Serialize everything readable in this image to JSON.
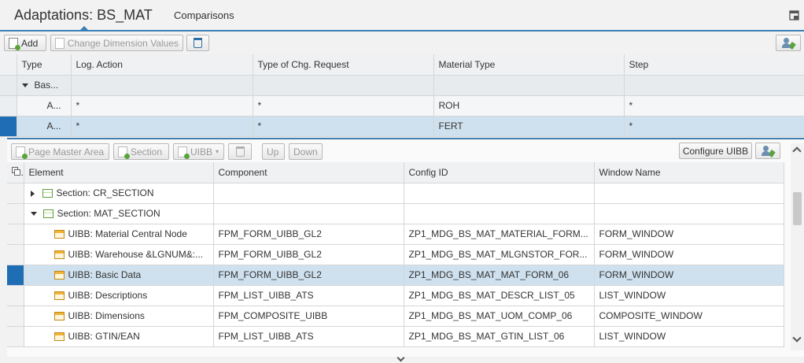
{
  "header": {
    "title": "Adaptations: BS_MAT",
    "tab_comparisons": "Comparisons"
  },
  "toolbar1": {
    "add": "Add",
    "change_dim": "Change Dimension Values"
  },
  "adapt_table": {
    "columns": [
      "Type",
      "Log. Action",
      "Type of Chg. Request",
      "Material Type",
      "Step"
    ],
    "group_row": {
      "type": "Bas..."
    },
    "rows": [
      {
        "type": "A...",
        "log_action": "*",
        "chg_request": "*",
        "material_type": "ROH",
        "step": "*"
      },
      {
        "type": "A...",
        "log_action": "*",
        "chg_request": "*",
        "material_type": "FERT",
        "step": "*"
      }
    ]
  },
  "toolbar2": {
    "page_master": "Page Master Area",
    "section": "Section",
    "uibb": "UIBB",
    "up": "Up",
    "down": "Down",
    "configure": "Configure UIBB"
  },
  "element_table": {
    "columns": [
      "Element",
      "Component",
      "Config ID",
      "Window Name"
    ],
    "sections": [
      "Section: CR_SECTION",
      "Section: MAT_SECTION"
    ],
    "rows": [
      {
        "element": "UIBB: Material Central Node",
        "component": "FPM_FORM_UIBB_GL2",
        "config_id": "ZP1_MDG_BS_MAT_MATERIAL_FORM...",
        "window": "FORM_WINDOW"
      },
      {
        "element": "UIBB: Warehouse &LGNUM&:...",
        "component": "FPM_FORM_UIBB_GL2",
        "config_id": "ZP1_MDG_BS_MAT_MLGNSTOR_FOR...",
        "window": "FORM_WINDOW"
      },
      {
        "element": "UIBB: Basic Data",
        "component": "FPM_FORM_UIBB_GL2",
        "config_id": "ZP1_MDG_BS_MAT_MAT_FORM_06",
        "window": "FORM_WINDOW"
      },
      {
        "element": "UIBB: Descriptions",
        "component": "FPM_LIST_UIBB_ATS",
        "config_id": "ZP1_MDG_BS_MAT_DESCR_LIST_05",
        "window": "LIST_WINDOW"
      },
      {
        "element": "UIBB: Dimensions",
        "component": "FPM_COMPOSITE_UIBB",
        "config_id": "ZP1_MDG_BS_MAT_UOM_COMP_06",
        "window": "COMPOSITE_WINDOW"
      },
      {
        "element": "UIBB: GTIN/EAN",
        "component": "FPM_LIST_UIBB_ATS",
        "config_id": "ZP1_MDG_BS_MAT_GTIN_LIST_06",
        "window": "LIST_WINDOW"
      }
    ]
  }
}
